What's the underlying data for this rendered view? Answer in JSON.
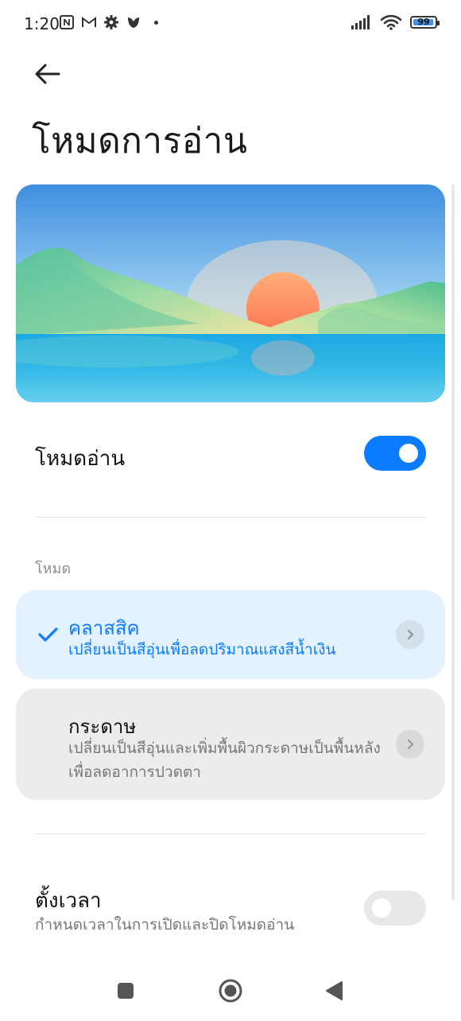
{
  "status_bar": {
    "time": "1:20",
    "battery": "99",
    "icons": [
      "nfc-icon",
      "gmail-icon",
      "gear-icon",
      "tulip-icon",
      "dot-icon"
    ]
  },
  "header": {
    "title": "โหมดการอ่าน"
  },
  "reading_mode": {
    "label": "โหมดอ่าน",
    "enabled": true
  },
  "modes_section": {
    "heading": "โหมด",
    "options": [
      {
        "title": "คลาสสิค",
        "subtitle": "เปลี่ยนเป็นสีอุ่นเพื่อลดปริมาณแสงสีน้ำเงิน",
        "selected": true
      },
      {
        "title": "กระดาษ",
        "subtitle": "เปลี่ยนเป็นสีอุ่นและเพิ่มพื้นผิวกระดาษเป็นพื้นหลังเพื่อลดอาการปวดตา",
        "selected": false
      }
    ]
  },
  "schedule": {
    "label": "ตั้งเวลา",
    "subtitle": "กำหนดเวลาในการเปิดและปิดโหมดอ่าน",
    "enabled": false
  },
  "colors": {
    "accent": "#0a7cff",
    "selected_card_bg": "#e4f1ff",
    "card_bg": "#ececec"
  }
}
